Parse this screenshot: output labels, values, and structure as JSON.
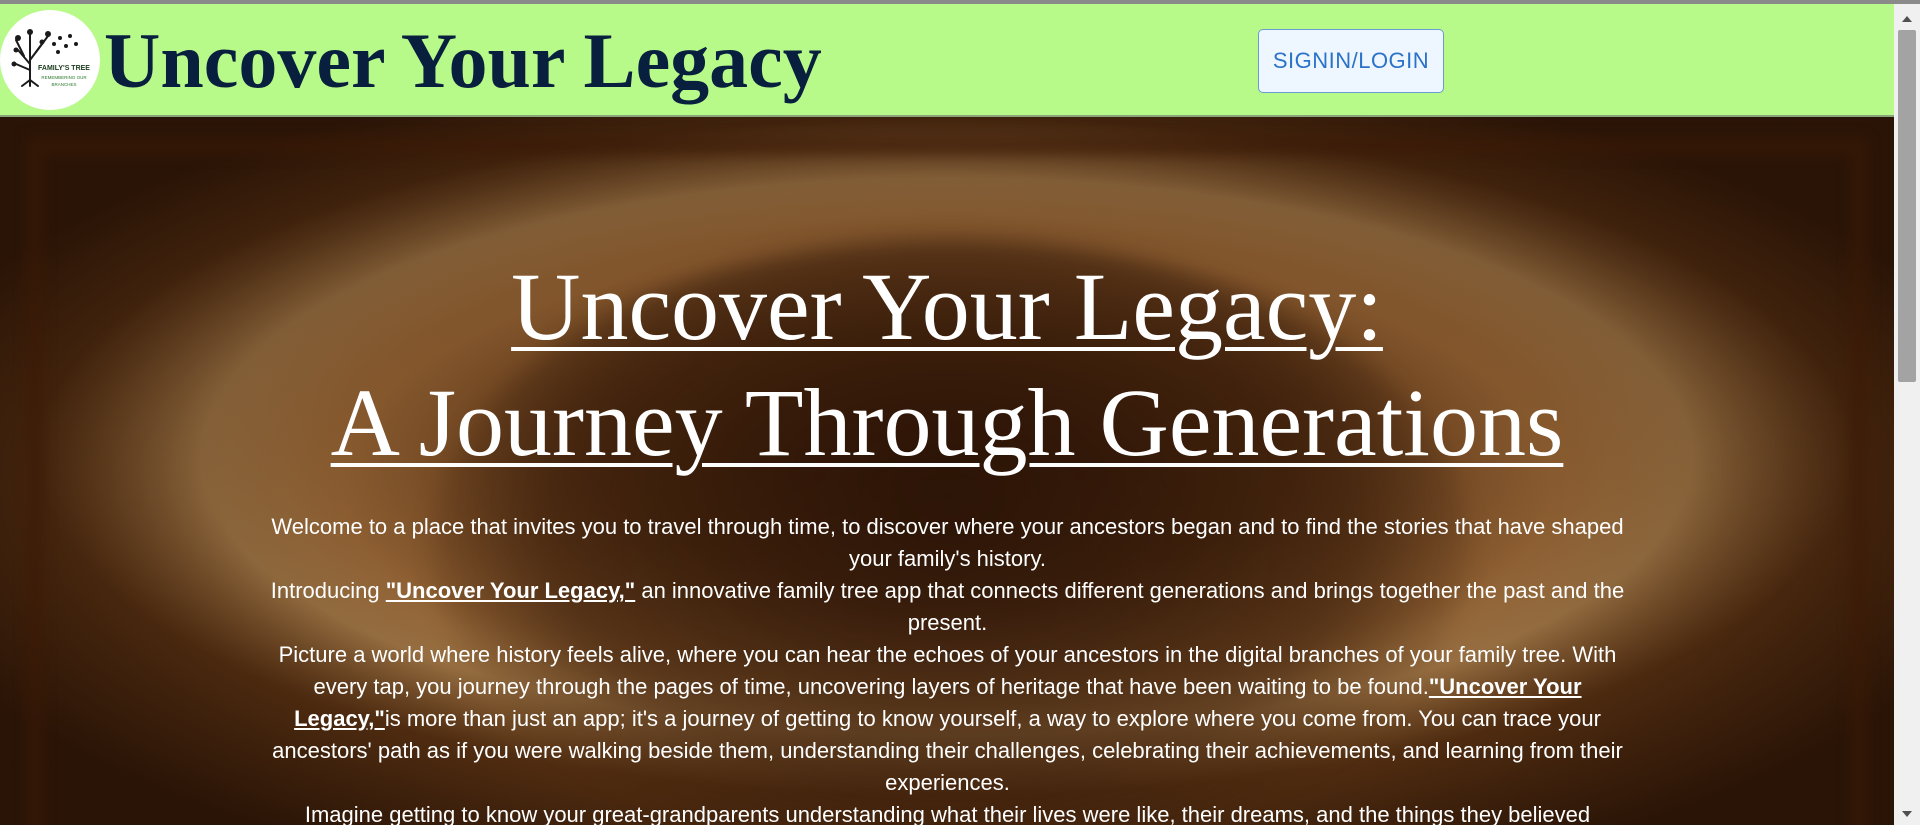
{
  "header": {
    "brand_title": "Uncover Your Legacy",
    "signin_label": "SIGNIN/LOGIN",
    "logo": {
      "icon": "family-tree-logo",
      "line1": "FAMILY'S TREE",
      "line2": "REMEMBERING OUR",
      "line3": "BRANCHES"
    }
  },
  "hero": {
    "heading_line1": "Uncover Your Legacy:",
    "heading_line2": "A Journey Through Generations",
    "para1": "Welcome to a place that invites you to travel through time, to discover where your ancestors began and to find the stories that have shaped your family's history.",
    "para2_before": "Introducing ",
    "para2_link": "\"Uncover Your Legacy,\"",
    "para2_after": " an innovative family tree app that connects different generations and brings together the past and the present.",
    "para3_before": "Picture a world where history feels alive, where you can hear the echoes of your ancestors in the digital branches of your family tree. With every tap, you journey through the pages of time, uncovering layers of heritage that have been waiting to be found.",
    "para3_link": "\"Uncover Your Legacy,\"",
    "para3_after": "is more than just an app; it's a journey of getting to know yourself, a way to explore where you come from. You can trace your ancestors' path as if you were walking beside them, understanding their challenges, celebrating their achievements, and learning from their experiences.",
    "para4": "Imagine getting to know your great-grandparents understanding what their lives were like, their dreams, and the things they believed"
  },
  "colors": {
    "header_bg": "#b8fa8a",
    "brand_title": "#08203e",
    "signin_text": "#2a73c9",
    "hero_text": "#ffffff"
  }
}
